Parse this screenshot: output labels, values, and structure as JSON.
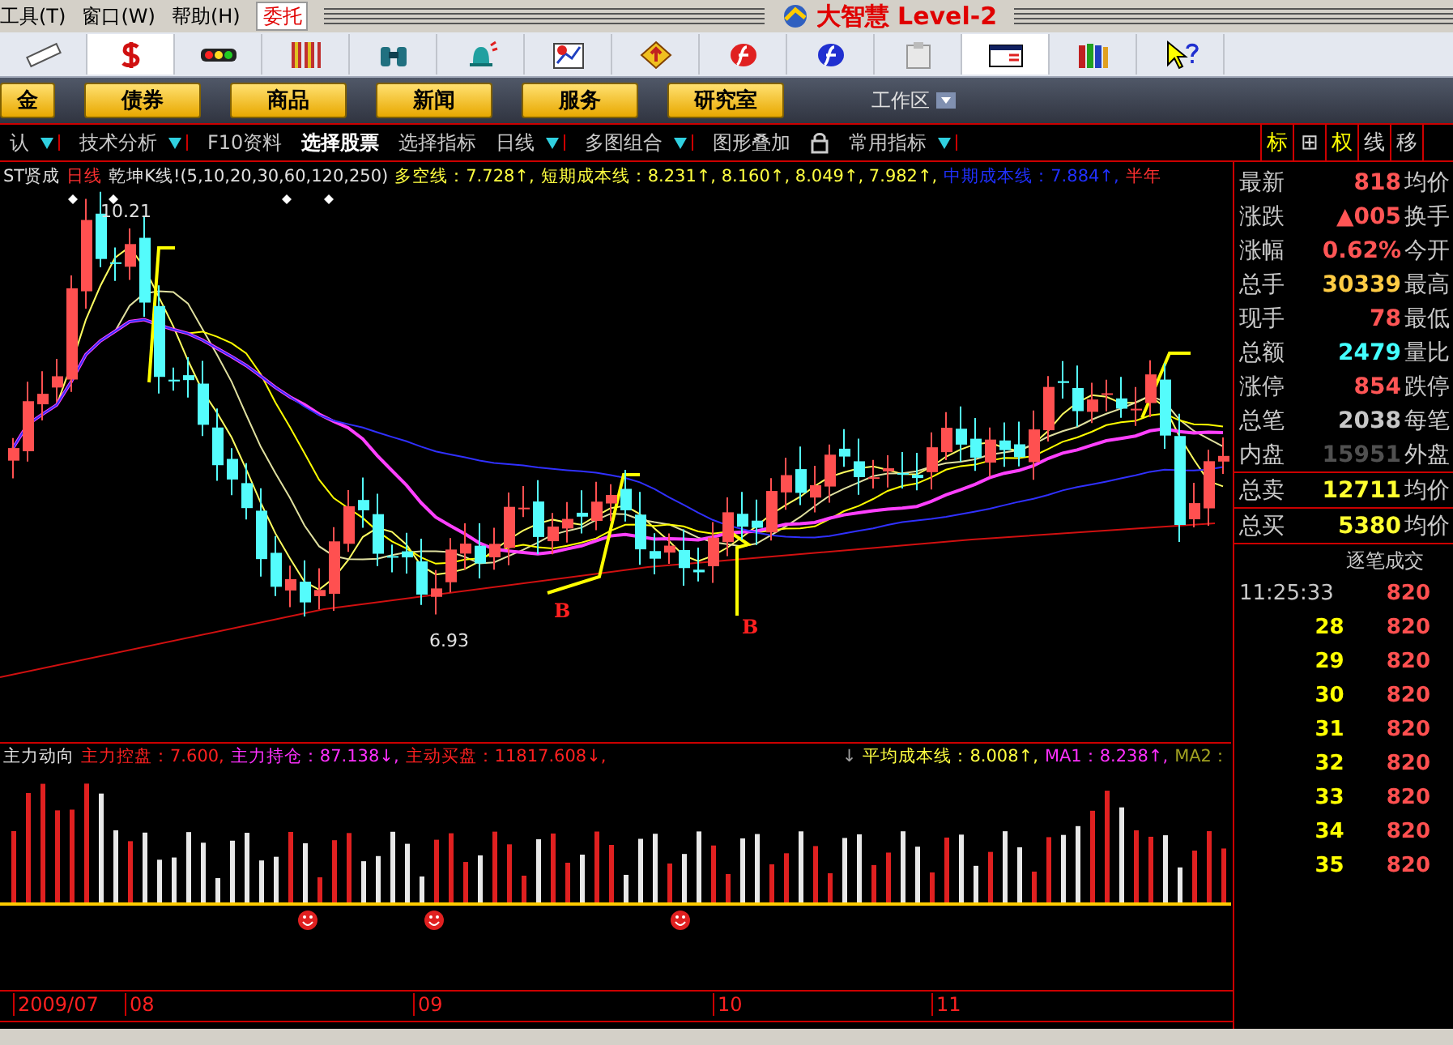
{
  "menu": {
    "items": [
      "工具(T)",
      "窗口(W)",
      "帮助(H)"
    ],
    "trade_button": "委托",
    "app_title": "大智慧 Level-2"
  },
  "toolbar": [
    {
      "kind": "ruler",
      "selected": false
    },
    {
      "kind": "dollar",
      "selected": true
    },
    {
      "kind": "lights",
      "selected": false
    },
    {
      "kind": "stripes",
      "selected": false
    },
    {
      "kind": "binoculars",
      "selected": false
    },
    {
      "kind": "bell",
      "selected": false
    },
    {
      "kind": "report",
      "selected": false
    },
    {
      "kind": "diamond",
      "selected": false
    },
    {
      "kind": "f-red",
      "selected": false
    },
    {
      "kind": "f-blue",
      "selected": false
    },
    {
      "kind": "clipboard",
      "selected": false
    },
    {
      "kind": "window",
      "selected": true
    },
    {
      "kind": "books",
      "selected": false
    },
    {
      "kind": "help",
      "selected": false
    }
  ],
  "nav_buttons": [
    "金",
    "债券",
    "商品",
    "新闻",
    "服务",
    "研究室"
  ],
  "workspace": "工作区",
  "tabs": [
    {
      "label": "认",
      "dropdown": true,
      "selected": false
    },
    {
      "label": "技术分析",
      "dropdown": true,
      "selected": false
    },
    {
      "label": "F10资料",
      "dropdown": false,
      "selected": false
    },
    {
      "label": "选择股票",
      "dropdown": false,
      "selected": true
    },
    {
      "label": "选择指标",
      "dropdown": false,
      "selected": false
    },
    {
      "label": "日线",
      "dropdown": true,
      "selected": false
    },
    {
      "label": "多图组合",
      "dropdown": true,
      "selected": false
    },
    {
      "label": "图形叠加",
      "dropdown": false,
      "selected": false
    },
    {
      "label": "常用指标",
      "dropdown": true,
      "selected": false
    }
  ],
  "side_tabs": [
    {
      "label": "标",
      "active": true
    },
    {
      "label": "⊞",
      "active": false
    },
    {
      "label": "权",
      "active": true
    },
    {
      "label": "线",
      "active": false
    },
    {
      "label": "移",
      "active": false
    }
  ],
  "chart": {
    "legend": [
      {
        "text": "ST贤成",
        "color": "#e0e0e0"
      },
      {
        "text": "日线",
        "color": "#ff3030"
      },
      {
        "text": "乾坤K线!(5,10,20,30,60,120,250)",
        "color": "#e0e0e0"
      },
      {
        "text": "多空线：7.728↑,",
        "color": "#ffff40"
      },
      {
        "text": "短期成本线：8.231↑, 8.160↑, 8.049↑, 7.982↑,",
        "color": "#ffff40"
      },
      {
        "text": "中期成本线：7.884↑,",
        "color": "#2030ff"
      },
      {
        "text": "半年",
        "color": "#ff3030"
      }
    ],
    "high_label": "10.21",
    "low_label": "6.93",
    "signals": [
      "B",
      "B"
    ]
  },
  "indicator": {
    "legend": [
      {
        "text": "主力动向",
        "color": "#e0e0e0"
      },
      {
        "text": "主力控盘：7.600,",
        "color": "#ff2020"
      },
      {
        "text": "主力持仓：87.138↓,",
        "color": "#ff30ff"
      },
      {
        "text": "主动买盘：11817.608↓,",
        "color": "#ff2020"
      }
    ],
    "legend_right": [
      {
        "text": "↓",
        "color": "#a0a0a0"
      },
      {
        "text": "平均成本线：8.008↑,",
        "color": "#ffff40"
      },
      {
        "text": "MA1：8.238↑,",
        "color": "#ff30ff"
      },
      {
        "text": "MA2：",
        "color": "#a0a020"
      }
    ]
  },
  "dates": [
    "2009/07",
    "08",
    "09",
    "10",
    "11"
  ],
  "quote": {
    "rows": [
      {
        "label": "最新",
        "value": "818",
        "color": "#ff5555",
        "right": "均价"
      },
      {
        "label": "涨跌",
        "value": "▲005",
        "color": "#ff5555",
        "right": "换手"
      },
      {
        "label": "涨幅",
        "value": "0.62%",
        "color": "#ff5555",
        "right": "今开"
      },
      {
        "label": "总手",
        "value": "30339",
        "color": "#ffcc44",
        "right": "最高"
      },
      {
        "label": "现手",
        "value": "78",
        "color": "#ff5555",
        "right": "最低"
      },
      {
        "label": "总额",
        "value": "2479",
        "color": "#44ffff",
        "right": "量比"
      },
      {
        "label": "涨停",
        "value": "854",
        "color": "#ff5555",
        "right": "跌停"
      },
      {
        "label": "总笔",
        "value": "2038",
        "color": "#c8c8c8",
        "right": "每笔"
      },
      {
        "label": "内盘",
        "value": "15951",
        "color": "#505050",
        "right": "外盘"
      }
    ],
    "totals": [
      {
        "label": "总卖",
        "value": "12711",
        "color": "#ffff30",
        "right": "均价"
      },
      {
        "label": "总买",
        "value": "5380",
        "color": "#ffff30",
        "right": "均价"
      }
    ]
  },
  "trades": {
    "title": "逐笔成交",
    "rows": [
      {
        "time": "11:25:33",
        "price": "820"
      },
      {
        "time": "28",
        "price": "820"
      },
      {
        "time": "29",
        "price": "820"
      },
      {
        "time": "30",
        "price": "820"
      },
      {
        "time": "31",
        "price": "820"
      },
      {
        "time": "32",
        "price": "820"
      },
      {
        "time": "33",
        "price": "820"
      },
      {
        "time": "34",
        "price": "820"
      },
      {
        "time": "35",
        "price": "820"
      }
    ]
  }
}
